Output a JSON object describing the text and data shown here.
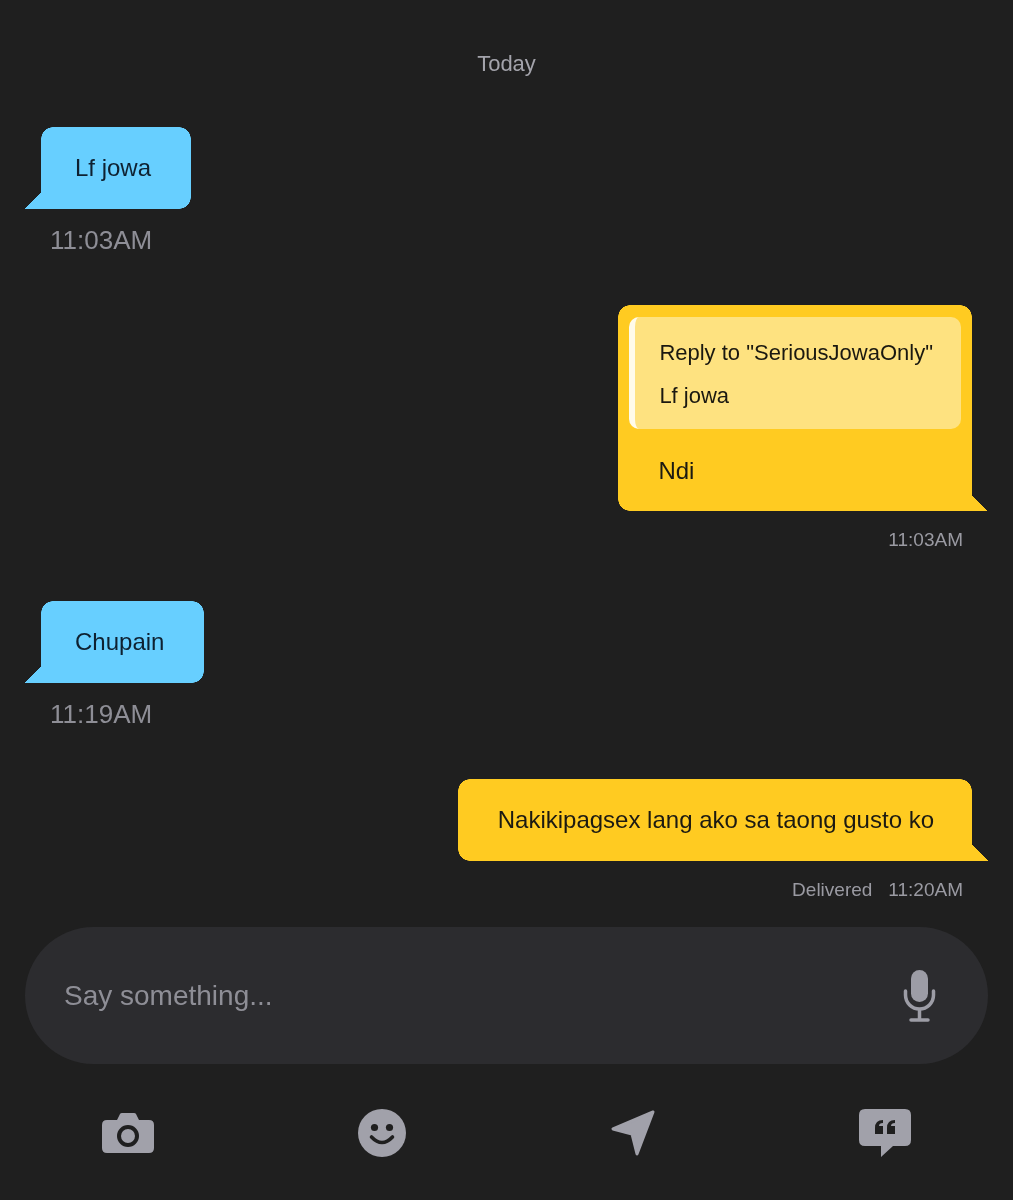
{
  "date_label": "Today",
  "messages": [
    {
      "kind": "incoming",
      "text": "Lf jowa",
      "time": "11:03AM"
    },
    {
      "kind": "outgoing",
      "reply": {
        "title": "Reply to \"SeriousJowaOnly\"",
        "text": "Lf jowa"
      },
      "text": "Ndi",
      "time": "11:03AM"
    },
    {
      "kind": "incoming",
      "text": "Chupain",
      "time": "11:19AM"
    },
    {
      "kind": "outgoing",
      "text": "Nakikipagsex lang ako sa taong gusto ko",
      "status": "Delivered",
      "time": "11:20AM"
    }
  ],
  "composer": {
    "placeholder": "Say something..."
  }
}
